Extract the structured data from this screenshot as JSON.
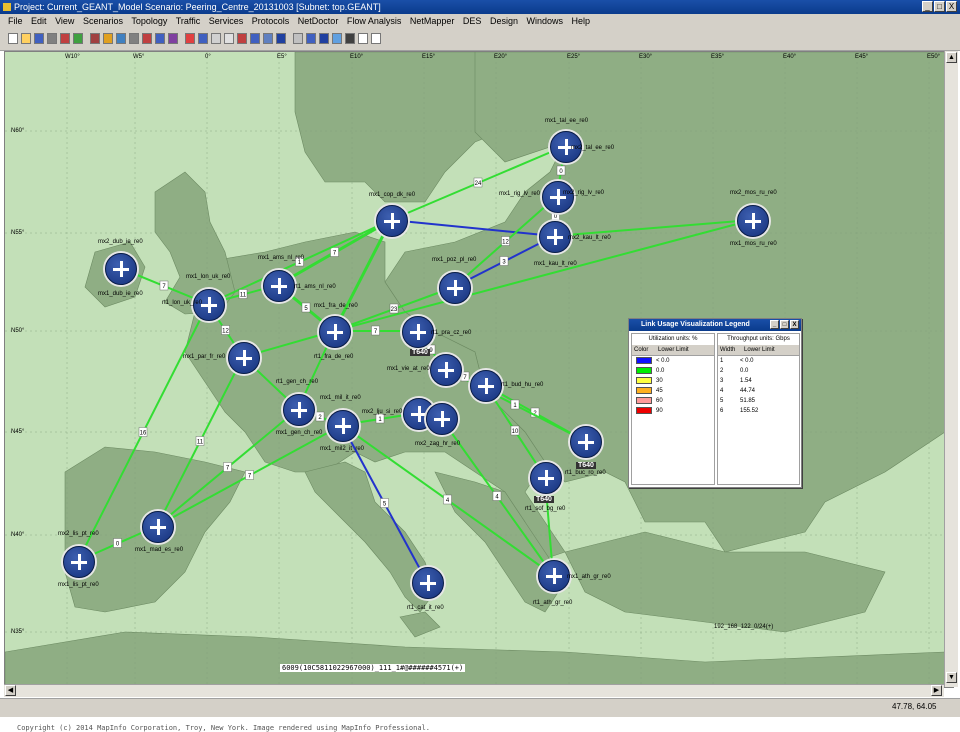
{
  "window": {
    "title": "Project: Current_GEANT_Model Scenario: Peering_Centre_20131003  [Subnet: top.GEANT]",
    "buttons": [
      "_",
      "□",
      "X"
    ]
  },
  "menu": [
    "File",
    "Edit",
    "View",
    "Scenarios",
    "Topology",
    "Traffic",
    "Services",
    "Protocols",
    "NetDoctor",
    "Flow Analysis",
    "NetMapper",
    "DES",
    "Design",
    "Windows",
    "Help"
  ],
  "map": {
    "lon_labels": [
      "W10°",
      "W5°",
      "0°",
      "E5°",
      "E10°",
      "E15°",
      "E20°",
      "E25°",
      "E30°",
      "E35°",
      "E40°",
      "E45°",
      "E50°"
    ],
    "lat_labels": [
      "N60°",
      "N55°",
      "N50°",
      "N45°",
      "N40°",
      "N35°"
    ],
    "copyright": "Copyright (c) 2014 MapInfo Corporation, Troy, New York. Image rendered using MapInfo Professional.",
    "hash_label": "6009(10C5811022967000)_111_1#@######4571(+)",
    "ip_label": "192_168_122_0/24(+)",
    "nodes": [
      {
        "id": "mx1_tal_ee",
        "label": "mx1_tal_ee_re0",
        "label2": "mx2_tal_ee_re0"
      },
      {
        "id": "mx1_rig_lv",
        "label": "mx1_rig_lv_re0",
        "label2": "mx2_rig_lv_re0"
      },
      {
        "id": "mx1_cop_dk",
        "label": "mx1_cop_dk_re0"
      },
      {
        "id": "mx2_kau_lt",
        "label": "mx2_kau_lt_re0",
        "label2": "mx1_kau_lt_re0"
      },
      {
        "id": "mx2_mos_ru",
        "label": "mx2_mos_ru_re0",
        "label2": "mx1_mos_ru_re0"
      },
      {
        "id": "mx2_dub_ie",
        "label": "mx2_dub_ie_re0",
        "label2": "mx1_dub_ie_re0"
      },
      {
        "id": "mx1_lon_uk",
        "label": "mx1_lon_uk_re0",
        "label2": "rt1_lon_uk_re0"
      },
      {
        "id": "mx1_ams_nl",
        "label": "mx1_ams_nl_re0",
        "label2": "rt1_ams_nl_re0"
      },
      {
        "id": "mx1_poz_pl",
        "label": "mx1_poz_pl_re0"
      },
      {
        "id": "mx1_fra_de",
        "label": "mx1_fra_de_re0",
        "label2": "rt1_fra_de_re0"
      },
      {
        "id": "mx1_par_fr",
        "label": "mx1_par_fr_re0"
      },
      {
        "id": "rt1_pra_cz",
        "label": "rt1_pra_cz_re0"
      },
      {
        "id": "mx1_vie_at",
        "label": "mx1_vie_at_re0"
      },
      {
        "id": "rt1_bud_hu",
        "label": "rt1_bud_hu_re0"
      },
      {
        "id": "rt1_gen_ch",
        "label": "rt1_gen_ch_re0",
        "label2": "mx1_gen_ch_re0"
      },
      {
        "id": "mx1_mil_it",
        "label": "mx1_mil_it_re0",
        "label2": "mx1_mil2_it_re0"
      },
      {
        "id": "mx2_lju_si",
        "label": "mx2_lju_si_re0"
      },
      {
        "id": "mx2_zag_hr",
        "label": "mx2_zag_hr_re0"
      },
      {
        "id": "rt1_buc_ro",
        "label": "rt1_buc_ro_re0"
      },
      {
        "id": "rt1_sof_bg",
        "label": "rt1_sof_bg_re0"
      },
      {
        "id": "mx2_lis_pt",
        "label": "mx2_lis_pt_re0",
        "label2": "mx1_lis_pt_re0"
      },
      {
        "id": "mx1_mad_es",
        "label": "mx1_mad_es_re0"
      },
      {
        "id": "mx1_ath_gr",
        "label": "mx1_ath_gr_re0",
        "label2": "rt1_ath_gr_re0"
      },
      {
        "id": "rt1_cat_it",
        "label": "rt1_cat_it_re0"
      }
    ],
    "tags": [
      "T640",
      "T640",
      "T640"
    ],
    "link_labels": [
      "24",
      "12",
      "3",
      "7",
      "1",
      "7",
      "11",
      "12",
      "5",
      "23",
      "7",
      "16",
      "11",
      "11",
      "7",
      "7",
      "9",
      "10",
      "10",
      "4",
      "4",
      "5",
      "6",
      "2",
      "2",
      "1"
    ]
  },
  "legend": {
    "title": "Link Usage Visualization Legend",
    "buttons": [
      "_",
      "□",
      "X"
    ],
    "util_title": "Utilization units: %",
    "util_headers": [
      "Color",
      "Lower Limit"
    ],
    "util_rows": [
      {
        "color": "#1010ff",
        "value": "< 0.0"
      },
      {
        "color": "#00ee00",
        "value": "0.0"
      },
      {
        "color": "#ffff40",
        "value": "30"
      },
      {
        "color": "#ffb020",
        "value": "45"
      },
      {
        "color": "#ff9a9a",
        "value": "60"
      },
      {
        "color": "#ee0000",
        "value": "90"
      }
    ],
    "thr_title": "Throughput units: Gbps",
    "thr_headers": [
      "Width",
      "Lower Limit"
    ],
    "thr_rows": [
      {
        "width": "1",
        "value": "< 0.0"
      },
      {
        "width": "2",
        "value": "0.0"
      },
      {
        "width": "3",
        "value": "1.54"
      },
      {
        "width": "4",
        "value": "44.74"
      },
      {
        "width": "5",
        "value": "51.85"
      },
      {
        "width": "6",
        "value": "155.52"
      }
    ]
  },
  "status": {
    "coords": "47.78, 64.05"
  },
  "colors": {
    "land": "#8fae84",
    "sea": "#c3e0b8",
    "link_green": "#33dd33",
    "link_blue": "#2233cc",
    "node": "#1d3a88"
  }
}
